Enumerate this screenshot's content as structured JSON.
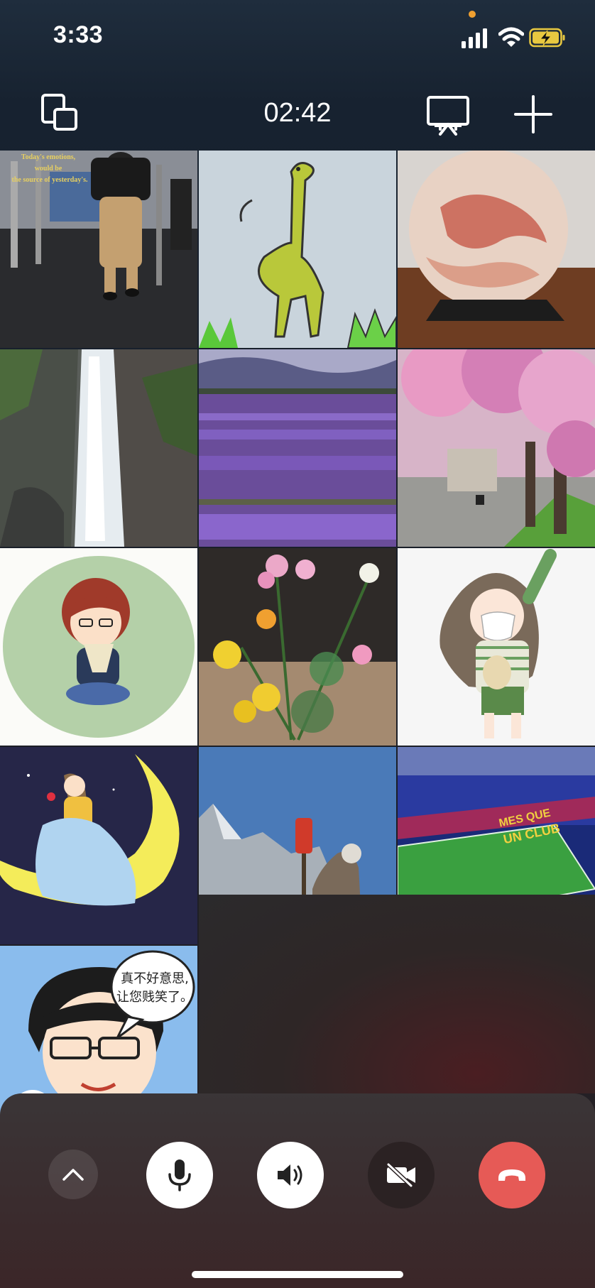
{
  "status_bar": {
    "time": "3:33",
    "privacy_dot_color": "#f0a030",
    "icons": [
      "cellular-signal-icon",
      "wifi-icon",
      "battery-charging-icon"
    ]
  },
  "call": {
    "elapsed": "02:42",
    "icons": {
      "switch_view": "window-switch-icon",
      "screen_share": "screen-share-icon",
      "add_member": "plus-icon"
    }
  },
  "participants": [
    {
      "id": "p1",
      "tile_text": [
        "Today's emotions,",
        "would be",
        "the source of yesterday's."
      ],
      "scene": "gym"
    },
    {
      "id": "p2",
      "scene": "giraffe drawing"
    },
    {
      "id": "p3",
      "scene": "stone plate"
    },
    {
      "id": "p4",
      "scene": "waterfall"
    },
    {
      "id": "p5",
      "scene": "lavender field"
    },
    {
      "id": "p6",
      "scene": "cherry blossoms"
    },
    {
      "id": "p7",
      "scene": "cartoon boy"
    },
    {
      "id": "p8",
      "scene": "flowers"
    },
    {
      "id": "p9",
      "scene": "cartoon girl"
    },
    {
      "id": "p10",
      "scene": "moon girl"
    },
    {
      "id": "p11",
      "scene": "mountain traveler"
    },
    {
      "id": "p12",
      "tile_text": [
        "MES QUE",
        "UN CLUB"
      ],
      "scene": "stadium"
    },
    {
      "id": "p13",
      "speech_bubble": [
        "真不好意思,",
        "让您贱笑了。"
      ],
      "scene": "cartoon avatar",
      "speaking": true
    }
  ],
  "controls": {
    "expand": "chevron-up-icon",
    "mic": "microphone-icon",
    "speaker": "speaker-icon",
    "camera": "camera-off-icon",
    "hangup": "hang-up-icon",
    "hangup_color": "#e65a56"
  }
}
